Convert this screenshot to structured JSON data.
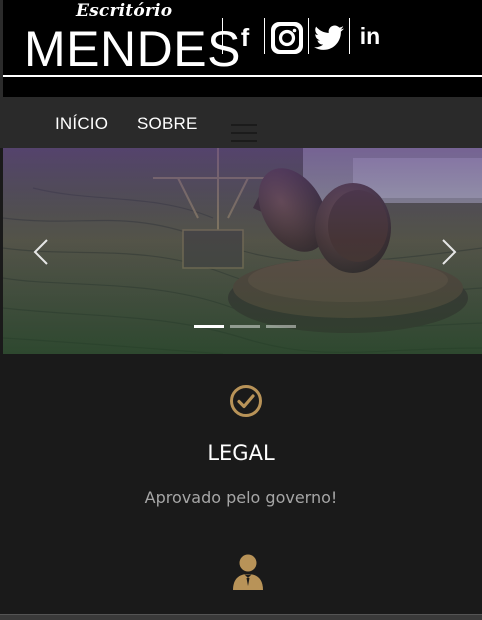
{
  "header": {
    "brand_small": "Escritório",
    "brand_big": "MENDES",
    "social": [
      {
        "name": "facebook",
        "glyph": "f"
      },
      {
        "name": "instagram",
        "glyph": ""
      },
      {
        "name": "twitter",
        "glyph": ""
      },
      {
        "name": "linkedin",
        "glyph": "in"
      }
    ]
  },
  "nav": {
    "items": [
      {
        "label": "INÍCIO"
      },
      {
        "label": "SOBRE"
      }
    ]
  },
  "carousel": {
    "slide_count": 3,
    "active_index": 0
  },
  "feature": {
    "icon": "check-circle-icon",
    "title": "LEGAL",
    "description": "Aprovado pelo governo!",
    "next_icon": "lawyer-icon"
  },
  "colors": {
    "accent_gold": "#b89358",
    "background": "#1a1a1a",
    "nav_background": "#2a2a2a"
  }
}
